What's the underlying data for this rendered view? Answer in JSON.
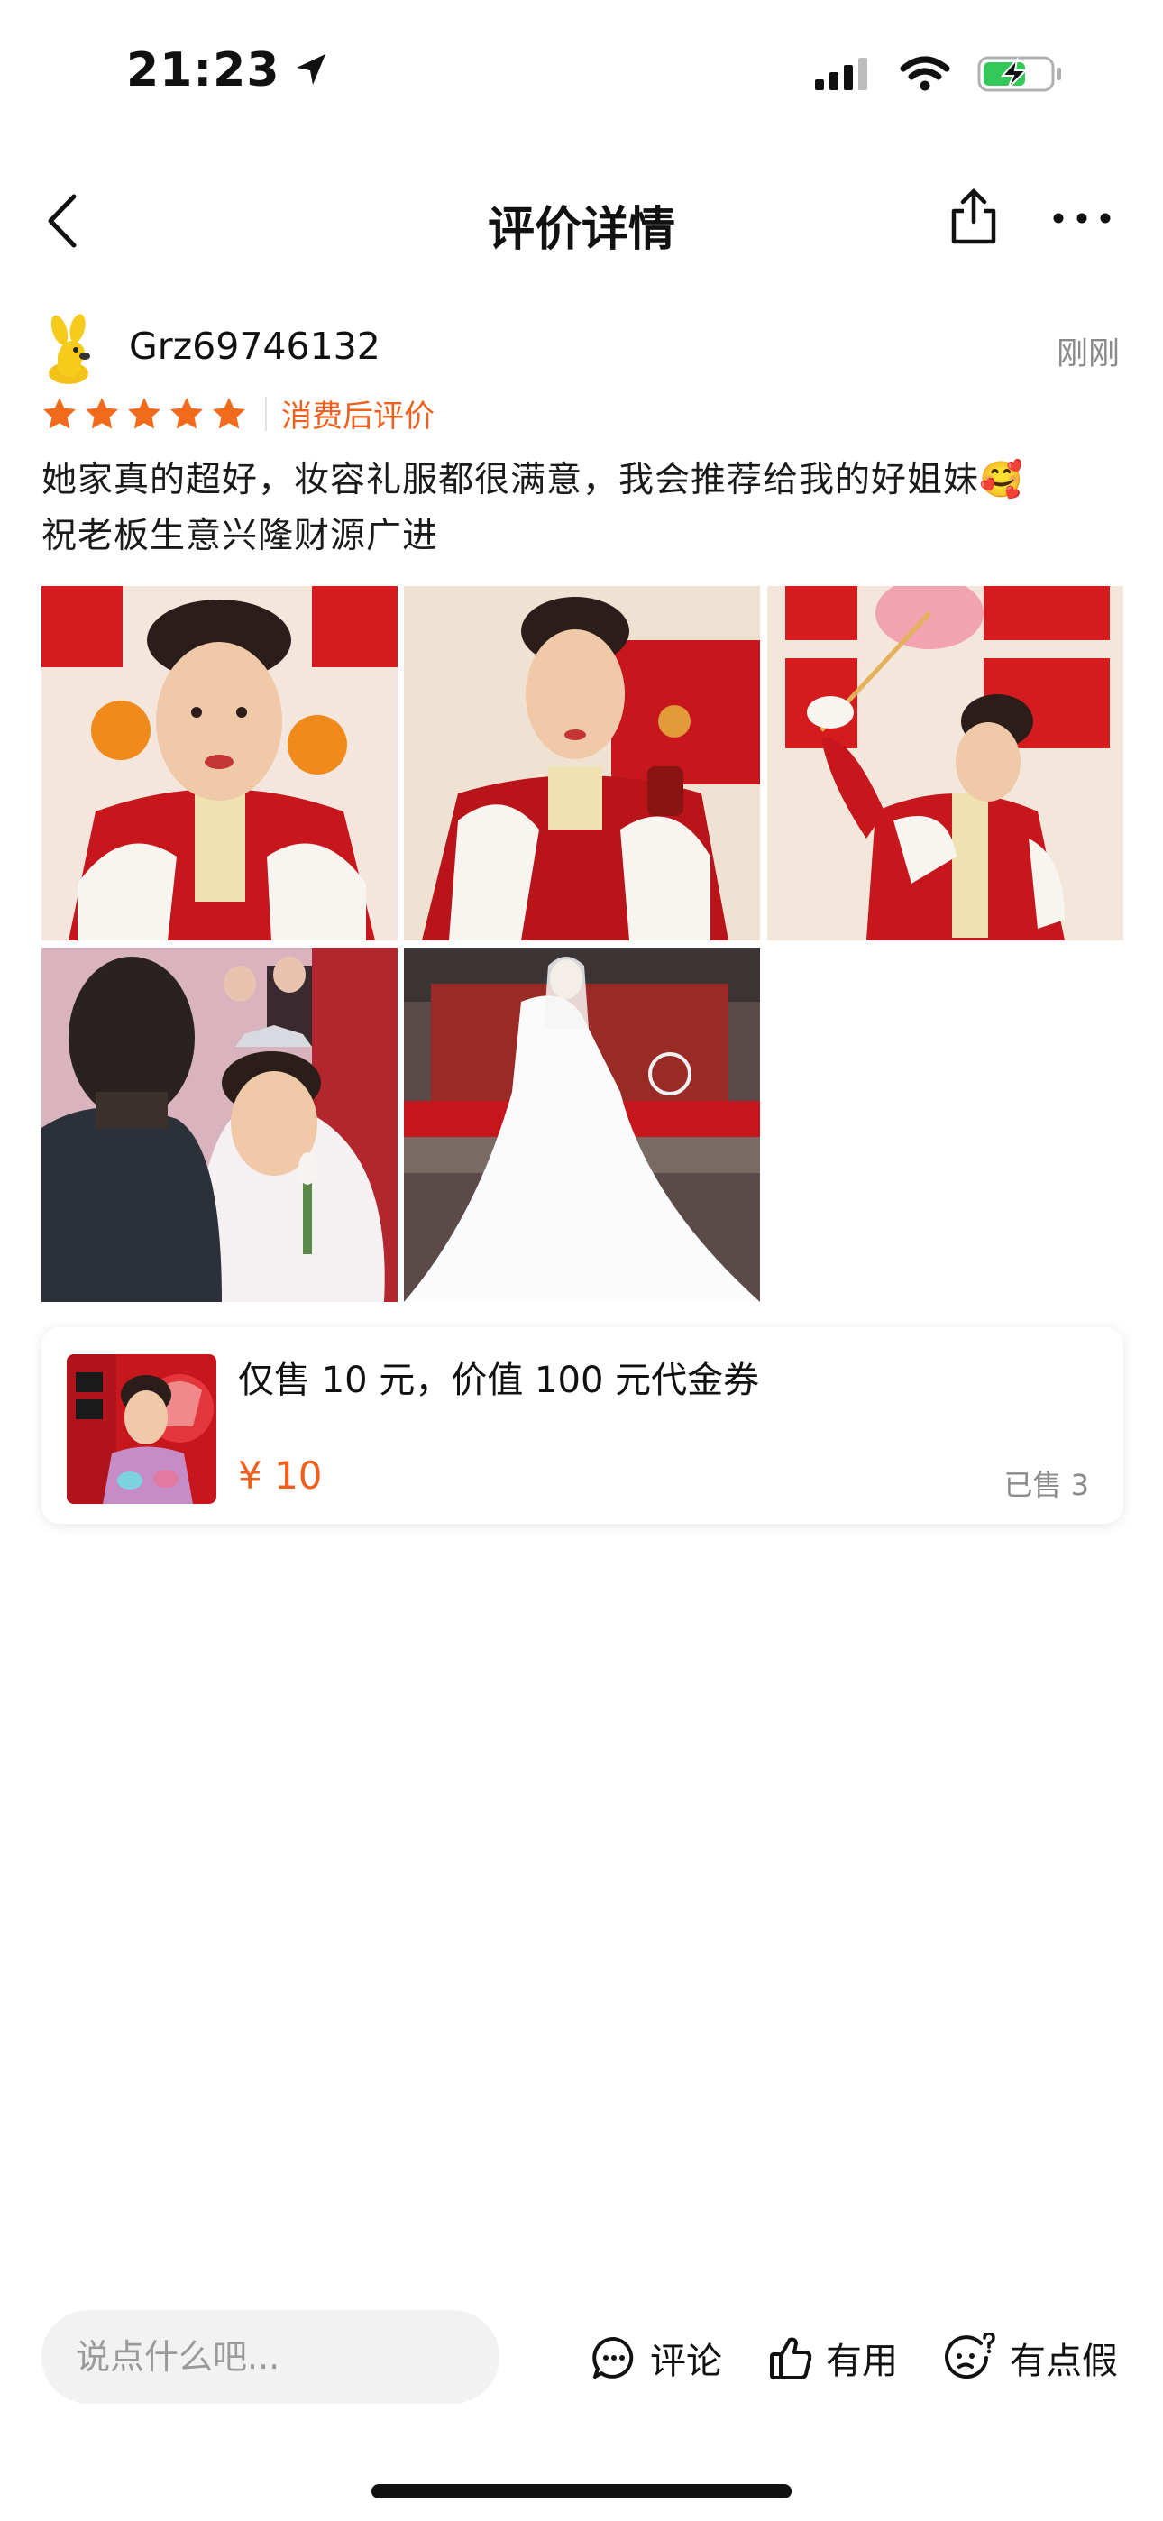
{
  "status_bar": {
    "time": "21:23",
    "icons": [
      "location-arrow-icon",
      "cellular-signal-icon",
      "wifi-icon",
      "battery-charging-icon"
    ]
  },
  "nav": {
    "title": "评价详情",
    "icons": [
      "back-chevron-icon",
      "share-icon",
      "more-icon"
    ]
  },
  "review": {
    "username": "Grz69746132",
    "time": "刚刚",
    "stars": 5,
    "rating_label": "消费后评价",
    "text_line1": "她家真的超好，妆容礼服都很满意，我会推荐给我的好姐妹🥰",
    "text_line2": "祝老板生意兴隆财源广进",
    "photo_count": 5
  },
  "product": {
    "title": "仅售 10 元，价值 100 元代金券",
    "price": "¥ 10",
    "sold": "已售 3"
  },
  "bottom_bar": {
    "input_placeholder": "说点什么吧...",
    "comment_label": "评论",
    "useful_label": "有用",
    "fake_label": "有点假"
  },
  "colors": {
    "accent_orange": "#f0601c",
    "star_orange": "#f26a1b",
    "muted_text": "#8a8a8a",
    "wedding_red": "#c8161d",
    "battery_green": "#34c759"
  }
}
